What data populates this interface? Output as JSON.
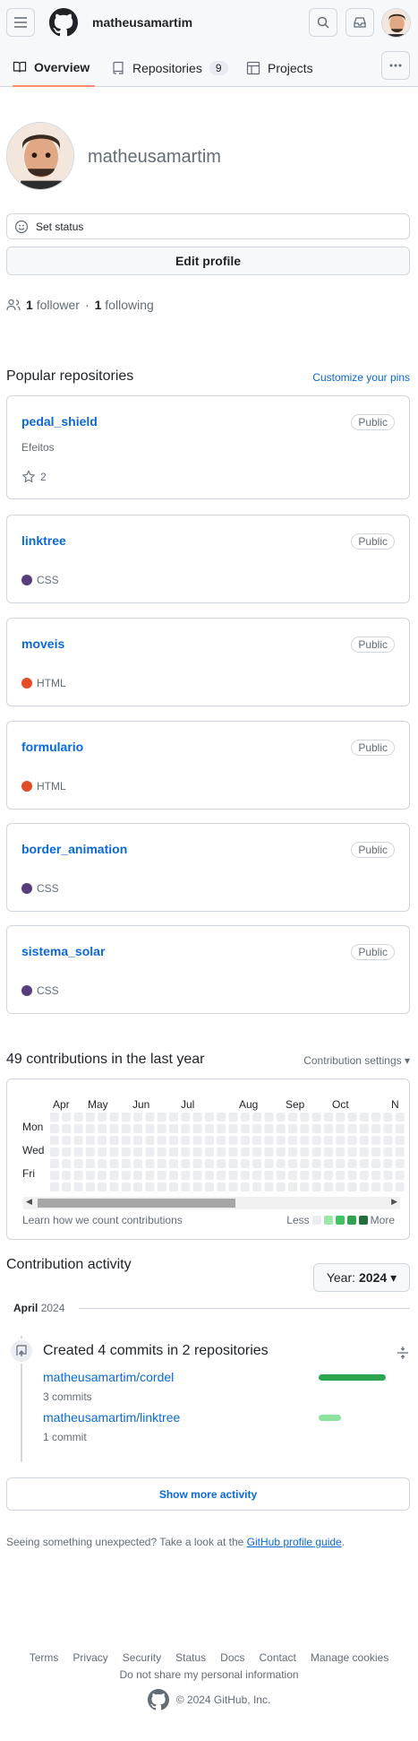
{
  "header": {
    "username": "matheusamartim"
  },
  "tabs": [
    {
      "label": "Overview"
    },
    {
      "label": "Repositories",
      "count": "9"
    },
    {
      "label": "Projects"
    }
  ],
  "profile": {
    "name": "matheusamartim",
    "set_status": "Set status",
    "edit_profile": "Edit profile",
    "followers_count": "1",
    "followers_label": "follower",
    "sep": "·",
    "following_count": "1",
    "following_label": "following"
  },
  "popular": {
    "title": "Popular repositories",
    "customize": "Customize your pins",
    "repos": [
      {
        "name": "pedal_shield",
        "visibility": "Public",
        "description": "Efeitos",
        "stars": "2"
      },
      {
        "name": "linktree",
        "visibility": "Public",
        "language": "CSS",
        "color": "#563d7c"
      },
      {
        "name": "moveis",
        "visibility": "Public",
        "language": "HTML",
        "color": "#e34c26"
      },
      {
        "name": "formulario",
        "visibility": "Public",
        "language": "HTML",
        "color": "#e34c26"
      },
      {
        "name": "border_animation",
        "visibility": "Public",
        "language": "CSS",
        "color": "#563d7c"
      },
      {
        "name": "sistema_solar",
        "visibility": "Public",
        "language": "CSS",
        "color": "#563d7c"
      }
    ]
  },
  "contributions": {
    "title": "49 contributions in the last year",
    "settings": "Contribution settings",
    "months": [
      "Apr",
      "May",
      "Jun",
      "Jul",
      "Aug",
      "Sep",
      "Oct",
      "N"
    ],
    "days": [
      "Mon",
      "Wed",
      "Fri"
    ],
    "learn": "Learn how we count contributions",
    "less": "Less",
    "more": "More",
    "legend_colors": [
      "#ebedf0",
      "#9be9a8",
      "#40c463",
      "#30a14e",
      "#216e39"
    ]
  },
  "activity": {
    "title": "Contribution activity",
    "year_label": "Year:",
    "year": "2024",
    "month": "April",
    "month_year": "2024",
    "created": "Created 4 commits in 2 repositories",
    "repos": [
      {
        "name": "matheusamartim/cordel",
        "commits": "3 commits",
        "share": 0.75,
        "color": "#2da44e"
      },
      {
        "name": "matheusamartim/linktree",
        "commits": "1 commit",
        "share": 0.25,
        "color": "#8ee29f"
      }
    ],
    "show_more": "Show more activity"
  },
  "guide": {
    "text": "Seeing something unexpected? Take a look at the ",
    "link": "GitHub profile guide",
    "end": "."
  },
  "footer": {
    "links": [
      "Terms",
      "Privacy",
      "Security",
      "Status",
      "Docs",
      "Contact",
      "Manage cookies"
    ],
    "dnsmpi": "Do not share my personal information",
    "copyright": "© 2024 GitHub, Inc."
  }
}
